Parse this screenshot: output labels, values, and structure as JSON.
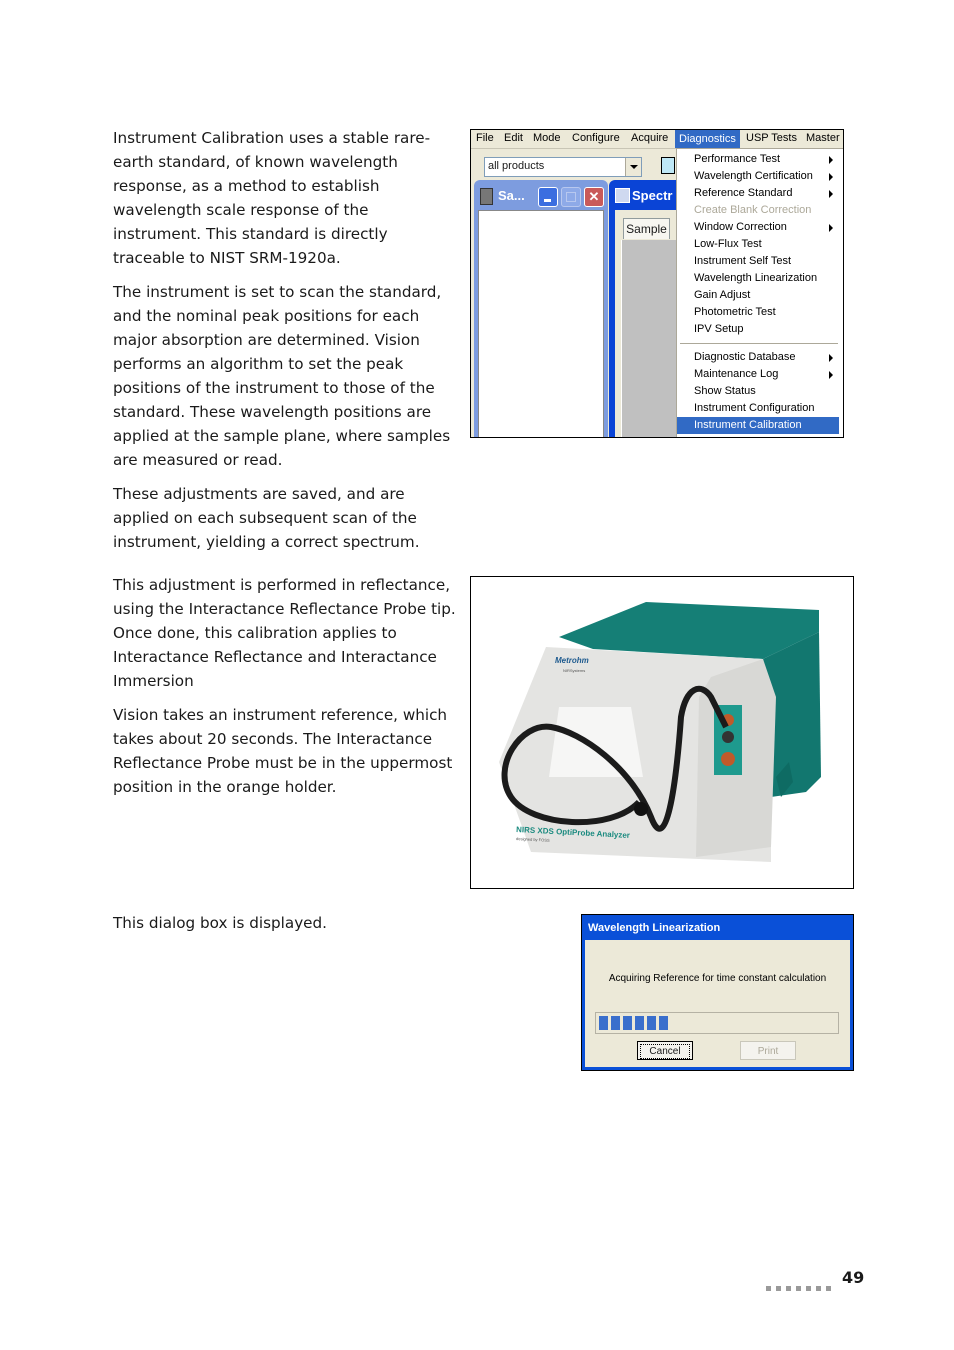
{
  "paragraphs": [
    "Instrument Calibration uses a stable rare-earth standard, of known wavelength response, as a method to establish wavelength scale response of the instrument. This standard is directly traceable to NIST SRM-1920a.",
    "The instrument is set to scan the standard, and the nominal peak positions for each major absorption are determined. Vision performs an algorithm to set the peak positions of the instrument to those of the standard. These wavelength positions are applied at the sample plane, where samples are measured or read.",
    "These adjustments are saved, and are applied on each subsequent scan of the instrument, yielding a correct spectrum.",
    "This adjustment is performed in reflectance, using the Interactance Reflectance Probe tip. Once done, this calibration applies to Interactance Reflectance and Interactance Immersion",
    "Vision takes an instrument reference, which takes about 20 seconds. The Interactance Reflectance Probe must be in the uppermost position in the orange holder.",
    "This dialog box is displayed."
  ],
  "app_screenshot": {
    "menubar": [
      "File",
      "Edit",
      "Mode",
      "Configure",
      "Acquire",
      "Diagnostics",
      "USP Tests",
      "Master"
    ],
    "active_menu": "Diagnostics",
    "product_combo": "all products",
    "window1_title": "Sa...",
    "window2_title": "Spectr",
    "tab_label": "Sample",
    "menu_items": [
      {
        "label": "Performance Test",
        "submenu": true,
        "disabled": false
      },
      {
        "label": "Wavelength Certification",
        "submenu": true,
        "disabled": false
      },
      {
        "label": "Reference Standard",
        "submenu": true,
        "disabled": false
      },
      {
        "label": "Create Blank Correction",
        "submenu": false,
        "disabled": true
      },
      {
        "label": "Window Correction",
        "submenu": true,
        "disabled": false
      },
      {
        "label": "Low-Flux Test",
        "submenu": false,
        "disabled": false
      },
      {
        "label": "Instrument Self Test",
        "submenu": false,
        "disabled": false
      },
      {
        "label": "Wavelength Linearization",
        "submenu": false,
        "disabled": false
      },
      {
        "label": "Gain Adjust",
        "submenu": false,
        "disabled": false
      },
      {
        "label": "Photometric Test",
        "submenu": false,
        "disabled": false
      },
      {
        "label": "IPV Setup",
        "submenu": false,
        "disabled": false
      },
      {
        "label": "Diagnostic Database",
        "submenu": true,
        "disabled": false
      },
      {
        "label": "Maintenance Log",
        "submenu": true,
        "disabled": false
      },
      {
        "label": "Show Status",
        "submenu": false,
        "disabled": false
      },
      {
        "label": "Instrument Configuration",
        "submenu": false,
        "disabled": false
      },
      {
        "label": "Instrument Calibration",
        "submenu": false,
        "disabled": false,
        "selected": true
      }
    ]
  },
  "photo": {
    "brand": "Metrohm",
    "brand_sub": "NIRSystems",
    "product_label": "NIRS XDS OptiProbe Analyzer",
    "designed_by": "designed by FOSS"
  },
  "dialog": {
    "title": "Wavelength Linearization",
    "message": "Acquiring Reference for time constant calculation",
    "progress_segments": 6,
    "progress_fraction": 0.3,
    "cancel_label": "Cancel",
    "print_label": "Print"
  },
  "footer": {
    "page_number": "49"
  },
  "colors": {
    "accent_teal": "#1a8a7f",
    "xp_blue": "#316ac5",
    "title_blue": "#0a50d8"
  }
}
